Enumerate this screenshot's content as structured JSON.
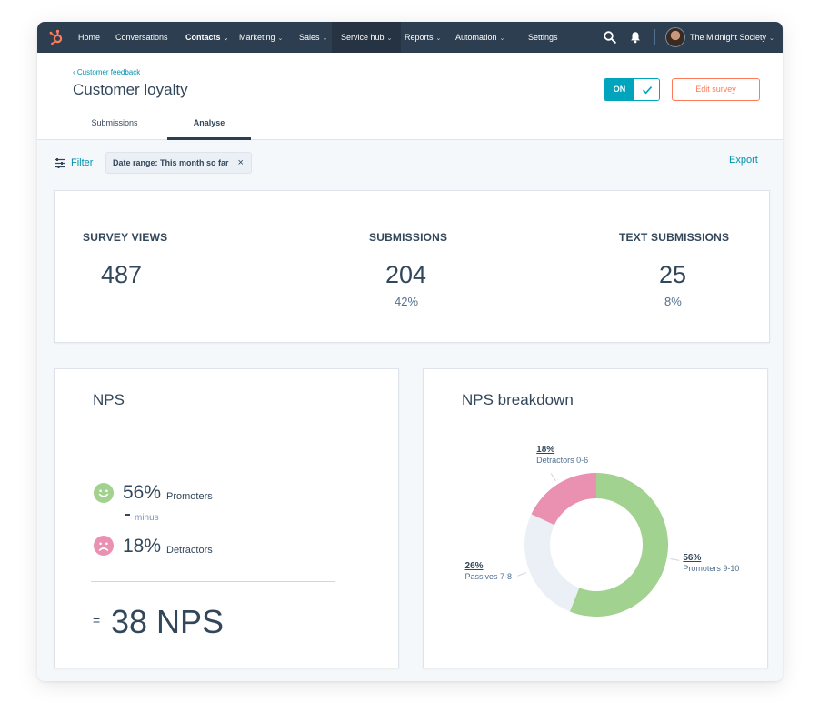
{
  "nav": {
    "items": [
      {
        "label": "Home",
        "chevron": false
      },
      {
        "label": "Conversations",
        "chevron": false
      },
      {
        "label": "Contacts",
        "chevron": true
      },
      {
        "label": "Marketing",
        "chevron": true
      },
      {
        "label": "Sales",
        "chevron": true
      },
      {
        "label": "Service hub",
        "chevron": true
      },
      {
        "label": "Reports",
        "chevron": true
      },
      {
        "label": "Automation",
        "chevron": true
      },
      {
        "label": "Settings",
        "chevron": false
      }
    ],
    "chevron_glyph": "⌄",
    "account_name": "The Midnight Society",
    "icons": [
      "sprocket-logo-icon",
      "search-icon",
      "bell-icon",
      "avatar",
      "chevron-down-icon"
    ]
  },
  "header": {
    "breadcrumb": "‹  Customer feedback",
    "title": "Customer loyalty",
    "toggle_label": "ON",
    "edit_button": "Edit survey",
    "tabs": [
      {
        "label": "Submissions",
        "active": false
      },
      {
        "label": "Analyse",
        "active": true
      }
    ]
  },
  "filter": {
    "label": "Filter",
    "chip_label": "Date range: This month so far",
    "chip_close": "×",
    "export_label": "Export"
  },
  "stats": [
    {
      "title": "SURVEY VIEWS",
      "value": "487",
      "sub": ""
    },
    {
      "title": "SUBMISSIONS",
      "value": "204",
      "sub": "42%"
    },
    {
      "title": "TEXT SUBMISSIONS",
      "value": "25",
      "sub": "8%"
    }
  ],
  "nps": {
    "title": "NPS",
    "promoters_pct": "56%",
    "promoters_label": "Promoters",
    "minus_label": "minus",
    "detractors_pct": "18%",
    "detractors_label": "Detractors",
    "equals": "=",
    "total": "38 NPS"
  },
  "colors": {
    "nav_bg": "#2d3e50",
    "accent_teal": "#00a4bd",
    "link": "#0091ae",
    "edit_orange": "#ff7a59",
    "promoter_green": "#a2d28f",
    "detractor_pink": "#ea90b1",
    "passive_gray": "#eaf0f6"
  },
  "chart_data": {
    "type": "pie",
    "title": "NPS breakdown",
    "categories": [
      "Promoters 9-10",
      "Passives 7-8",
      "Detractors 0-6"
    ],
    "values": [
      56,
      26,
      18
    ],
    "labels": [
      "56%",
      "26%",
      "18%"
    ],
    "colors": [
      "#a2d28f",
      "#eaf0f6",
      "#ea90b1"
    ],
    "donut": true
  }
}
